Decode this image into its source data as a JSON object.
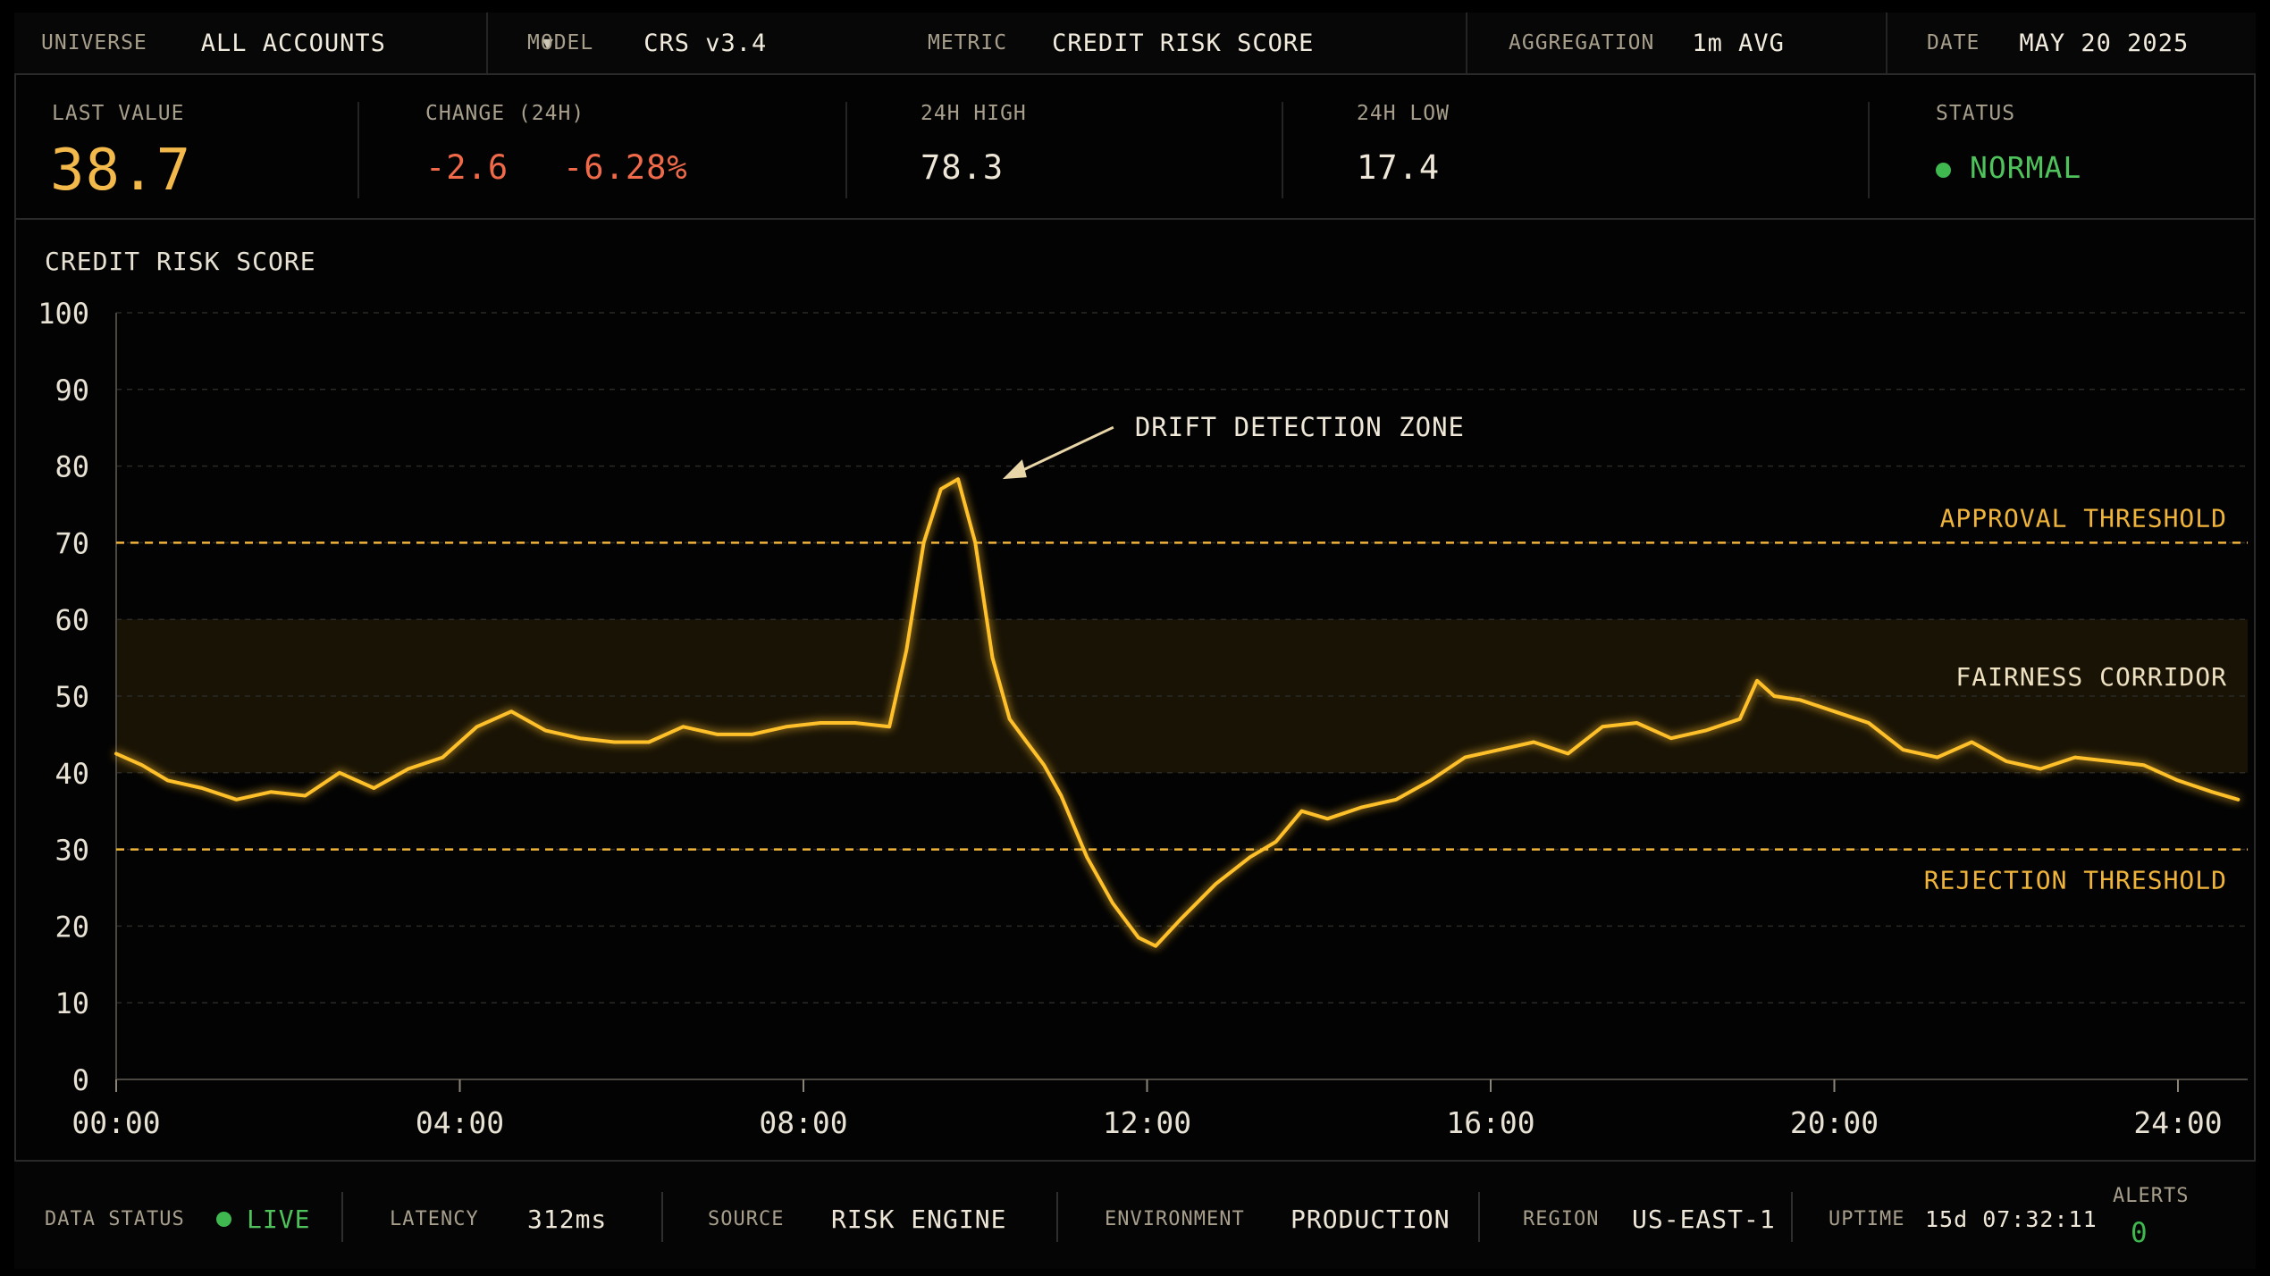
{
  "colors": {
    "accent": "#f0b43a",
    "line": "#ffc02a",
    "negative": "#f06a4a",
    "positive": "#3fb84f",
    "threshold": "#f0b43a"
  },
  "header": {
    "universe_label": "UNIVERSE",
    "universe_value": "ALL ACCOUNTS",
    "universe_caret": "▼",
    "model_label": "MODEL",
    "model_value": "CRS v3.4",
    "metric_label": "METRIC",
    "metric_value": "CREDIT RISK SCORE",
    "aggregation_label": "AGGREGATION",
    "aggregation_value": "1m AVG",
    "date_label": "DATE",
    "date_value": "MAY 20 2025"
  },
  "stats": {
    "last_label": "LAST VALUE",
    "last_value": "38.7",
    "change_label": "CHANGE (24H)",
    "change_abs": "-2.6",
    "change_pct": "-6.28%",
    "high_label": "24H HIGH",
    "high_value": "78.3",
    "low_label": "24H LOW",
    "low_value": "17.4",
    "status_label": "STATUS",
    "status_value": "NORMAL"
  },
  "footer": {
    "data_status_label": "DATA STATUS",
    "data_status_value": "LIVE",
    "latency_label": "LATENCY",
    "latency_value": "312ms",
    "source_label": "SOURCE",
    "source_value": "RISK ENGINE",
    "environment_label": "ENVIRONMENT",
    "environment_value": "PRODUCTION",
    "region_label": "REGION",
    "region_value": "US-EAST-1",
    "uptime_label": "UPTIME",
    "uptime_value": "15d 07:32:11",
    "alerts_label": "ALERTS",
    "alerts_value": "0"
  },
  "chart_data": {
    "type": "line",
    "title": "CREDIT RISK SCORE",
    "xlabel": "",
    "ylabel": "",
    "ylim": [
      0,
      100
    ],
    "xlim": [
      0,
      24.8
    ],
    "yticks": [
      0,
      10,
      20,
      30,
      40,
      50,
      60,
      70,
      80,
      90,
      100
    ],
    "ytick_labels": [
      "0",
      "10",
      "20",
      "30",
      "40",
      "50",
      "60",
      "70",
      "80",
      "90",
      "100"
    ],
    "xticks": [
      0,
      4,
      8,
      12,
      16,
      20,
      24
    ],
    "xtick_labels": [
      "00:00",
      "04:00",
      "08:00",
      "12:00",
      "16:00",
      "20:00",
      "24:00"
    ],
    "grid": true,
    "series": [
      {
        "x": [
          0,
          0.3,
          0.6,
          1.0,
          1.4,
          1.8,
          2.2,
          2.6,
          3.0,
          3.4,
          3.8,
          4.2,
          4.6,
          5.0,
          5.4,
          5.8,
          6.2,
          6.6,
          7.0,
          7.4,
          7.8,
          8.2,
          8.6,
          9.0,
          9.2,
          9.4,
          9.6,
          9.8,
          10.0,
          10.2,
          10.4,
          10.6,
          10.8,
          11.0,
          11.3,
          11.6,
          11.9,
          12.1,
          12.4,
          12.8,
          13.2,
          13.5,
          13.8,
          14.1,
          14.5,
          14.9,
          15.3,
          15.7,
          16.1,
          16.5,
          16.9,
          17.3,
          17.7,
          18.1,
          18.5,
          18.9,
          19.1,
          19.3,
          19.6,
          20.0,
          20.4,
          20.8,
          21.2,
          21.6,
          22.0,
          22.4,
          22.8,
          23.2,
          23.6,
          24.0,
          24.4,
          24.7
        ],
        "values": [
          42.5,
          41,
          39,
          38,
          36.5,
          37.5,
          37,
          40,
          38,
          40.5,
          42,
          46,
          48,
          45.5,
          44.5,
          44,
          44,
          46,
          45,
          45,
          46,
          46.5,
          46.5,
          46,
          56,
          70,
          77,
          78.3,
          70,
          55,
          47,
          44,
          41,
          37,
          29,
          23,
          18.5,
          17.4,
          21,
          25.5,
          29,
          31,
          35,
          34,
          35.5,
          36.5,
          39,
          42,
          43,
          44,
          42.5,
          46,
          46.5,
          44.5,
          45.5,
          47,
          52,
          50,
          49.5,
          48,
          46.5,
          43,
          42,
          44,
          41.5,
          40.5,
          42,
          41.5,
          41,
          39,
          37.5,
          36.5
        ]
      }
    ],
    "bands": [
      {
        "label": "FAIRNESS CORRIDOR",
        "from": 40,
        "to": 60
      }
    ],
    "thresholds": [
      {
        "label": "APPROVAL THRESHOLD",
        "value": 70
      },
      {
        "label": "REJECTION THRESHOLD",
        "value": 30
      }
    ],
    "annotation": {
      "label": "DRIFT DETECTION ZONE",
      "x": 9.85,
      "y": 78.3
    }
  }
}
